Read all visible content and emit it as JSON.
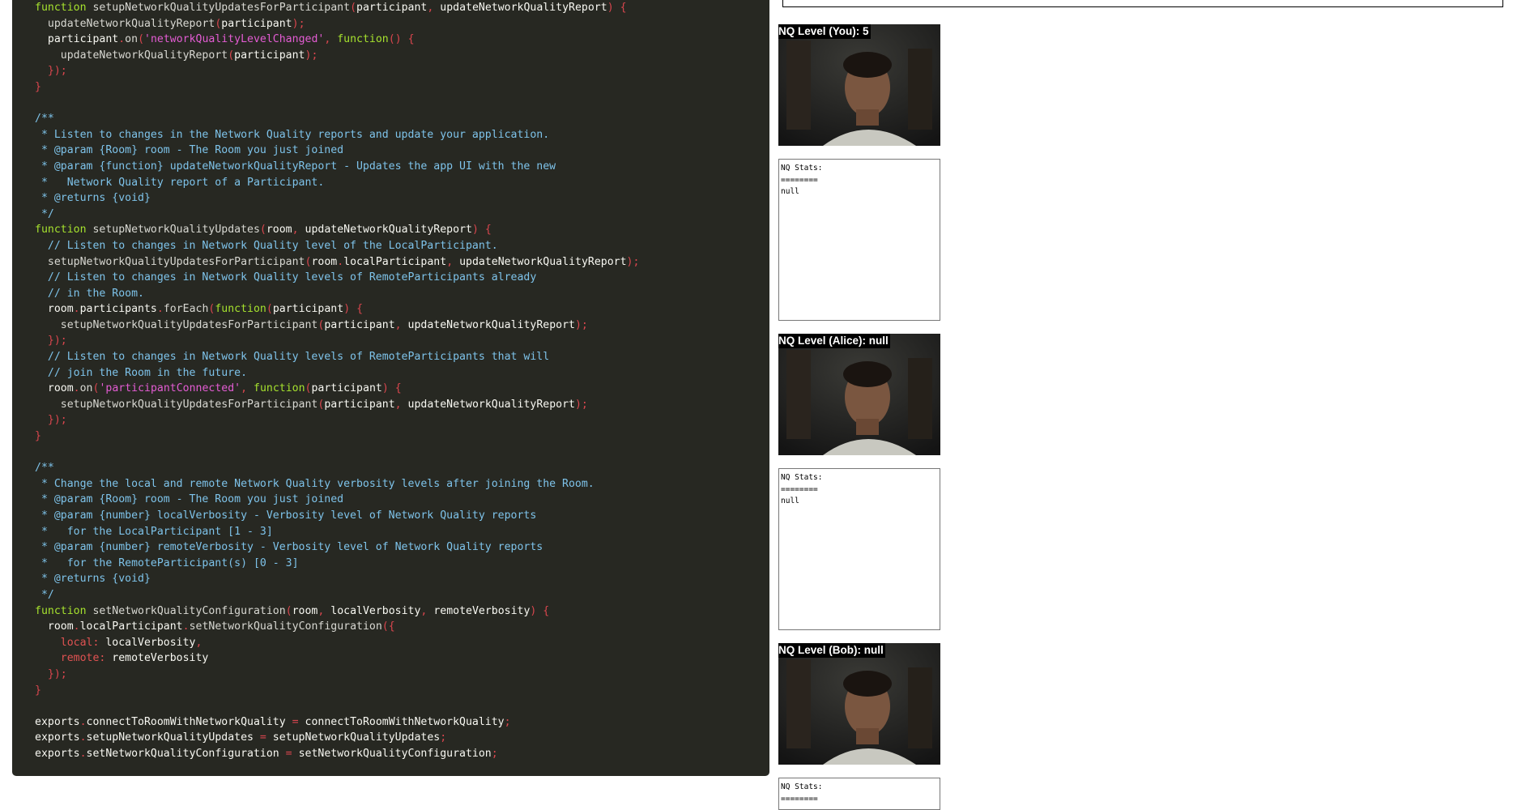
{
  "code_lines": [
    [
      [
        "k",
        "function "
      ],
      [
        "f",
        "setupNetworkQualityUpdatesForParticipant"
      ],
      [
        "p",
        "("
      ],
      [
        "v",
        "participant"
      ],
      [
        "p",
        ", "
      ],
      [
        "v",
        "updateNetworkQualityReport"
      ],
      [
        "p",
        ") {"
      ]
    ],
    [
      [
        "v",
        "  "
      ],
      [
        "f",
        "updateNetworkQualityReport"
      ],
      [
        "p",
        "("
      ],
      [
        "v",
        "participant"
      ],
      [
        "p",
        ");"
      ]
    ],
    [
      [
        "v",
        "  participant"
      ],
      [
        "p",
        "."
      ],
      [
        "f",
        "on"
      ],
      [
        "p",
        "("
      ],
      [
        "s",
        "'networkQualityLevelChanged'"
      ],
      [
        "p",
        ", "
      ],
      [
        "k",
        "function"
      ],
      [
        "p",
        "() {"
      ]
    ],
    [
      [
        "v",
        "    "
      ],
      [
        "f",
        "updateNetworkQualityReport"
      ],
      [
        "p",
        "("
      ],
      [
        "v",
        "participant"
      ],
      [
        "p",
        ");"
      ]
    ],
    [
      [
        "p",
        "  });"
      ]
    ],
    [
      [
        "p",
        "}"
      ]
    ],
    [
      [
        "v",
        ""
      ]
    ],
    [
      [
        "c",
        "/**"
      ]
    ],
    [
      [
        "c",
        " * Listen to changes in the Network Quality reports and update your application."
      ]
    ],
    [
      [
        "c",
        " * @param {Room} room - The Room you just joined"
      ]
    ],
    [
      [
        "c",
        " * @param {function} updateNetworkQualityReport - Updates the app UI with the new"
      ]
    ],
    [
      [
        "c",
        " *   Network Quality report of a Participant."
      ]
    ],
    [
      [
        "c",
        " * @returns {void}"
      ]
    ],
    [
      [
        "c",
        " */"
      ]
    ],
    [
      [
        "k",
        "function "
      ],
      [
        "f",
        "setupNetworkQualityUpdates"
      ],
      [
        "p",
        "("
      ],
      [
        "v",
        "room"
      ],
      [
        "p",
        ", "
      ],
      [
        "v",
        "updateNetworkQualityReport"
      ],
      [
        "p",
        ") {"
      ]
    ],
    [
      [
        "c",
        "  // Listen to changes in Network Quality level of the LocalParticipant."
      ]
    ],
    [
      [
        "v",
        "  "
      ],
      [
        "f",
        "setupNetworkQualityUpdatesForParticipant"
      ],
      [
        "p",
        "("
      ],
      [
        "v",
        "room"
      ],
      [
        "p",
        "."
      ],
      [
        "v",
        "localParticipant"
      ],
      [
        "p",
        ", "
      ],
      [
        "v",
        "updateNetworkQualityReport"
      ],
      [
        "p",
        ");"
      ]
    ],
    [
      [
        "c",
        "  // Listen to changes in Network Quality levels of RemoteParticipants already"
      ]
    ],
    [
      [
        "c",
        "  // in the Room."
      ]
    ],
    [
      [
        "v",
        "  room"
      ],
      [
        "p",
        "."
      ],
      [
        "v",
        "participants"
      ],
      [
        "p",
        "."
      ],
      [
        "f",
        "forEach"
      ],
      [
        "p",
        "("
      ],
      [
        "k",
        "function"
      ],
      [
        "p",
        "("
      ],
      [
        "v",
        "participant"
      ],
      [
        "p",
        ") {"
      ]
    ],
    [
      [
        "v",
        "    "
      ],
      [
        "f",
        "setupNetworkQualityUpdatesForParticipant"
      ],
      [
        "p",
        "("
      ],
      [
        "v",
        "participant"
      ],
      [
        "p",
        ", "
      ],
      [
        "v",
        "updateNetworkQualityReport"
      ],
      [
        "p",
        ");"
      ]
    ],
    [
      [
        "p",
        "  });"
      ]
    ],
    [
      [
        "c",
        "  // Listen to changes in Network Quality levels of RemoteParticipants that will"
      ]
    ],
    [
      [
        "c",
        "  // join the Room in the future."
      ]
    ],
    [
      [
        "v",
        "  room"
      ],
      [
        "p",
        "."
      ],
      [
        "f",
        "on"
      ],
      [
        "p",
        "("
      ],
      [
        "s",
        "'participantConnected'"
      ],
      [
        "p",
        ", "
      ],
      [
        "k",
        "function"
      ],
      [
        "p",
        "("
      ],
      [
        "v",
        "participant"
      ],
      [
        "p",
        ") {"
      ]
    ],
    [
      [
        "v",
        "    "
      ],
      [
        "f",
        "setupNetworkQualityUpdatesForParticipant"
      ],
      [
        "p",
        "("
      ],
      [
        "v",
        "participant"
      ],
      [
        "p",
        ", "
      ],
      [
        "v",
        "updateNetworkQualityReport"
      ],
      [
        "p",
        ");"
      ]
    ],
    [
      [
        "p",
        "  });"
      ]
    ],
    [
      [
        "p",
        "}"
      ]
    ],
    [
      [
        "v",
        ""
      ]
    ],
    [
      [
        "c",
        "/**"
      ]
    ],
    [
      [
        "c",
        " * Change the local and remote Network Quality verbosity levels after joining the Room."
      ]
    ],
    [
      [
        "c",
        " * @param {Room} room - The Room you just joined"
      ]
    ],
    [
      [
        "c",
        " * @param {number} localVerbosity - Verbosity level of Network Quality reports"
      ]
    ],
    [
      [
        "c",
        " *   for the LocalParticipant [1 - 3]"
      ]
    ],
    [
      [
        "c",
        " * @param {number} remoteVerbosity - Verbosity level of Network Quality reports"
      ]
    ],
    [
      [
        "c",
        " *   for the RemoteParticipant(s) [0 - 3]"
      ]
    ],
    [
      [
        "c",
        " * @returns {void}"
      ]
    ],
    [
      [
        "c",
        " */"
      ]
    ],
    [
      [
        "k",
        "function "
      ],
      [
        "f",
        "setNetworkQualityConfiguration"
      ],
      [
        "p",
        "("
      ],
      [
        "v",
        "room"
      ],
      [
        "p",
        ", "
      ],
      [
        "v",
        "localVerbosity"
      ],
      [
        "p",
        ", "
      ],
      [
        "v",
        "remoteVerbosity"
      ],
      [
        "p",
        ") {"
      ]
    ],
    [
      [
        "v",
        "  room"
      ],
      [
        "p",
        "."
      ],
      [
        "v",
        "localParticipant"
      ],
      [
        "p",
        "."
      ],
      [
        "f",
        "setNetworkQualityConfiguration"
      ],
      [
        "p",
        "({"
      ]
    ],
    [
      [
        "pr",
        "    local: "
      ],
      [
        "v",
        "localVerbosity"
      ],
      [
        "p",
        ","
      ]
    ],
    [
      [
        "pr",
        "    remote: "
      ],
      [
        "v",
        "remoteVerbosity"
      ]
    ],
    [
      [
        "p",
        "  });"
      ]
    ],
    [
      [
        "p",
        "}"
      ]
    ],
    [
      [
        "v",
        ""
      ]
    ],
    [
      [
        "v",
        "exports"
      ],
      [
        "p",
        "."
      ],
      [
        "v",
        "connectToRoomWithNetworkQuality "
      ],
      [
        "p",
        "= "
      ],
      [
        "v",
        "connectToRoomWithNetworkQuality"
      ],
      [
        "p",
        ";"
      ]
    ],
    [
      [
        "v",
        "exports"
      ],
      [
        "p",
        "."
      ],
      [
        "v",
        "setupNetworkQualityUpdates "
      ],
      [
        "p",
        "= "
      ],
      [
        "v",
        "setupNetworkQualityUpdates"
      ],
      [
        "p",
        ";"
      ]
    ],
    [
      [
        "v",
        "exports"
      ],
      [
        "p",
        "."
      ],
      [
        "v",
        "setNetworkQualityConfiguration "
      ],
      [
        "p",
        "= "
      ],
      [
        "v",
        "setNetworkQualityConfiguration"
      ],
      [
        "p",
        ";"
      ]
    ]
  ],
  "participants": [
    {
      "label": "NQ Level (You): 5",
      "stats": "NQ Stats:\n========\nnull"
    },
    {
      "label": "NQ Level (Alice): null",
      "stats": "NQ Stats:\n========\nnull"
    },
    {
      "label": "NQ Level (Bob): null",
      "stats": "NQ Stats:\n========"
    }
  ]
}
